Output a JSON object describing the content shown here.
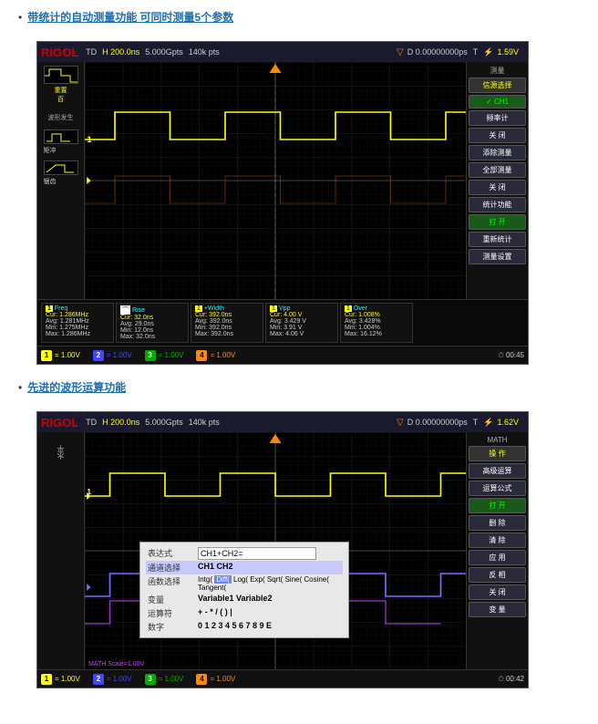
{
  "sections": [
    {
      "id": "section1",
      "title": "带统计的自动测量功能 可同时测量5个参数",
      "scope": {
        "logo": "RIGOL",
        "topbar": {
          "mode": "TD",
          "timeDiv": "H  200.0ns",
          "sampleRate": "5.000Gpts",
          "samplePts": "140k pts",
          "trigPos": "D  0.00000000ps",
          "trigStatus": "T",
          "voltage": "1.59V"
        },
        "rightPanel": {
          "label": "测量",
          "items": [
            {
              "text": "信源选择",
              "type": "header"
            },
            {
              "text": "✓ CH1",
              "type": "active"
            },
            {
              "text": "频率计",
              "type": "normal"
            },
            {
              "text": "关 闭",
              "type": "normal"
            },
            {
              "text": "添除测量",
              "type": "normal"
            },
            {
              "text": "全部测量",
              "type": "normal"
            },
            {
              "text": "关 闭",
              "type": "normal"
            },
            {
              "text": "统计功能",
              "type": "normal"
            },
            {
              "text": "打 开",
              "type": "active"
            },
            {
              "text": "重新统计",
              "type": "normal"
            },
            {
              "text": "测量设置",
              "type": "normal"
            }
          ]
        },
        "measurements": [
          {
            "label": "Freq",
            "cur": "1.286MHz",
            "avg": "1.281MHz",
            "min": "1.275MHz",
            "max": "1.286MHz"
          },
          {
            "label": "Rise",
            "cur": "32.0ns",
            "avg": "29.0ns",
            "min": "12.0ns",
            "max": "32.0ns"
          },
          {
            "label": "+Width",
            "cur": "392.0ns",
            "avg": "392.0ns",
            "min": "392.0ns",
            "max": "392.0ns"
          },
          {
            "label": "Vpp",
            "cur": "4.00 V",
            "avg": "3.429 V",
            "min": "3.91 V",
            "max": "4.06 V"
          },
          {
            "label": "Over",
            "cur": "1.008%",
            "avg": "3.428%",
            "min": "1.004%",
            "max": "16.12%"
          }
        ],
        "channels": [
          {
            "num": "1",
            "color": "#ff0",
            "value": "= 1.00V"
          },
          {
            "num": "2",
            "color": "#44f",
            "value": "= 1.00V"
          },
          {
            "num": "3",
            "color": "#0a0",
            "value": "= 1.00V"
          },
          {
            "num": "4",
            "color": "#f80",
            "value": "= 1.00V"
          }
        ],
        "time": "00:45"
      }
    },
    {
      "id": "section2",
      "title": "先进的波形运算功能",
      "scope": {
        "logo": "RIGOL",
        "topbar": {
          "mode": "TD",
          "timeDiv": "H  200.0ns",
          "sampleRate": "5.000Gpts",
          "samplePts": "140k pts",
          "trigPos": "D  0.00000000ps",
          "trigStatus": "T",
          "voltage": "1.62V"
        },
        "rightPanel": {
          "label": "MATH",
          "items": [
            {
              "text": "操 作",
              "type": "header"
            },
            {
              "text": "高级运算",
              "type": "normal"
            },
            {
              "text": "运算公式",
              "type": "normal"
            },
            {
              "text": "打 开",
              "type": "active"
            },
            {
              "text": "删 除",
              "type": "normal"
            },
            {
              "text": "清 除",
              "type": "normal"
            },
            {
              "text": "应 用",
              "type": "normal"
            },
            {
              "text": "反 相",
              "type": "normal"
            },
            {
              "text": "关 闭",
              "type": "normal"
            },
            {
              "text": "变 量",
              "type": "normal"
            }
          ]
        },
        "mathDialog": {
          "title": "",
          "rows": [
            {
              "label": "表达式",
              "value": "CH1+CH2="
            },
            {
              "label": "通道选择",
              "value": "CH1  CH2"
            },
            {
              "label": "函数选择",
              "value": "Intg( Diff( Log( Exp( Sqrt( Sine( Cosine( Tangent("
            },
            {
              "label": "变量",
              "value": "Variable1  Variable2"
            },
            {
              "label": "运算符",
              "value": "+ - * / ( )"
            },
            {
              "label": "数字",
              "value": "0 1 2 3 4 5 6 7 8 9  E"
            }
          ]
        },
        "channels": [
          {
            "num": "1",
            "color": "#ff0",
            "value": "= 1.00V"
          },
          {
            "num": "2",
            "color": "#44f",
            "value": "= 1.00V"
          },
          {
            "num": "3",
            "color": "#0a0",
            "value": "= 1.00V"
          },
          {
            "num": "4",
            "color": "#f80",
            "value": "= 1.00V"
          }
        ],
        "mathLabel": "MATH  Scale=1.00V",
        "time": "00:42"
      }
    }
  ]
}
